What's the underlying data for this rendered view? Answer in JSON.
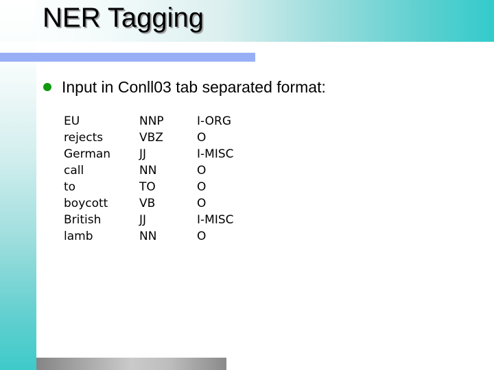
{
  "slide": {
    "title": "NER Tagging",
    "bullet": "Input in Conll03 tab separated format:",
    "colors": {
      "accent_bar": "#98aef5",
      "bullet": "#119a11",
      "teal": "#33cbcb"
    }
  },
  "conll": {
    "rows": [
      {
        "token": "EU",
        "pos": "NNP",
        "ner": "I-ORG"
      },
      {
        "token": "rejects",
        "pos": "VBZ",
        "ner": "O"
      },
      {
        "token": "German",
        "pos": "JJ",
        "ner": "I-MISC"
      },
      {
        "token": "call",
        "pos": "NN",
        "ner": "O"
      },
      {
        "token": "to",
        "pos": "TO",
        "ner": "O"
      },
      {
        "token": "boycott",
        "pos": "VB",
        "ner": "O"
      },
      {
        "token": "British",
        "pos": "JJ",
        "ner": "I-MISC"
      },
      {
        "token": "lamb",
        "pos": "NN",
        "ner": "O"
      }
    ]
  }
}
